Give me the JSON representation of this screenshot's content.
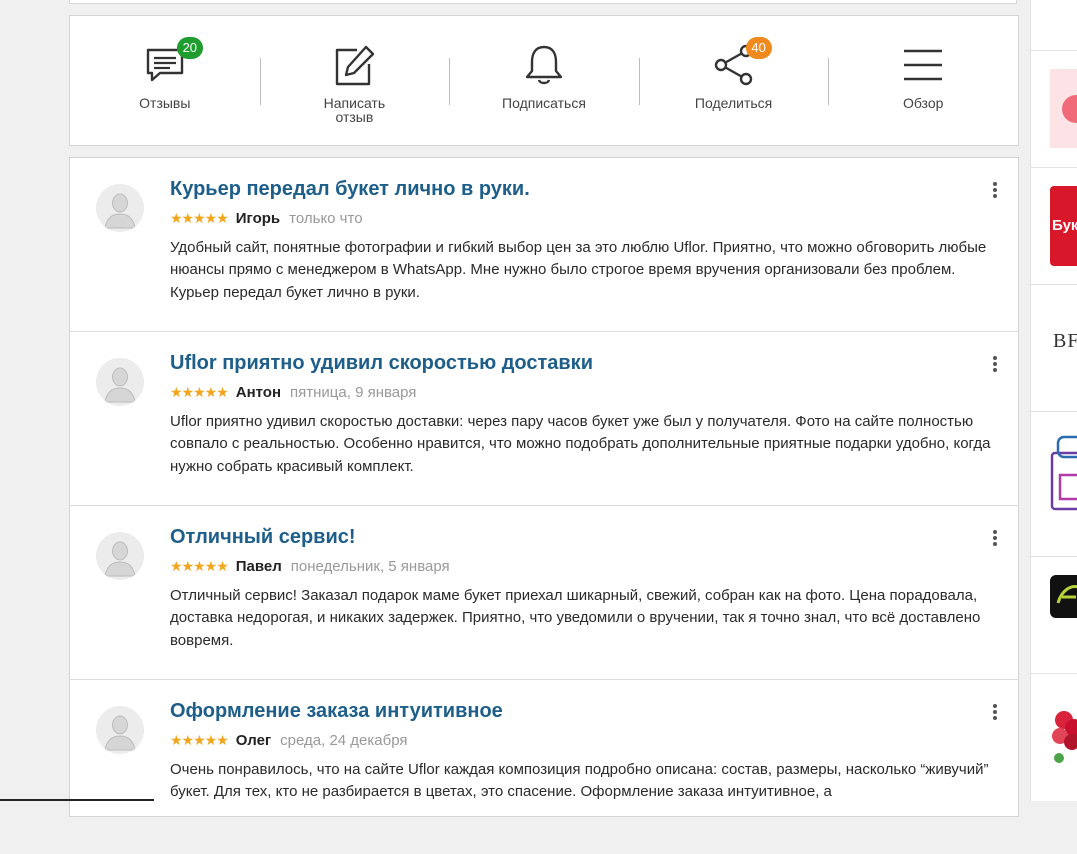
{
  "toolbar": {
    "items": [
      {
        "label": "Отзывы",
        "badge": "20",
        "icon": "comment-icon"
      },
      {
        "label": "Написать\nотзыв",
        "icon": "edit-icon"
      },
      {
        "label": "Подписаться",
        "icon": "bell-icon"
      },
      {
        "label": "Поделиться",
        "badge": "40",
        "icon": "share-icon"
      },
      {
        "label": "Обзор",
        "icon": "menu-icon"
      }
    ]
  },
  "colors": {
    "accent": "#1d5e8a",
    "stars": "#f3a51b",
    "badge_green": "#1f9d2e",
    "badge_orange": "#f08a1c"
  },
  "reviews": [
    {
      "title": "Курьер передал букет лично в руки.",
      "stars": "★★★★★",
      "rating": 5,
      "author": "Игорь",
      "date": "только что",
      "text": "Удобный сайт, понятные фотографии и гибкий выбор цен за это люблю Uflor. Приятно, что можно обговорить любые нюансы прямо с менеджером в WhatsApp. Мне нужно было строгое время вручения организовали без проблем. Курьер передал букет лично в руки."
    },
    {
      "title": "Uflor приятно удивил скоростью доставки",
      "stars": "★★★★★",
      "rating": 5,
      "author": "Антон",
      "date": "пятница, 9 января",
      "text": "Uflor приятно удивил скоростью доставки: через пару часов букет уже был у получателя. Фото на сайте полностью совпало с реальностью. Особенно нравится, что можно подобрать дополнительные приятные подарки удобно, когда нужно собрать красивый комплект."
    },
    {
      "title": "Отличный сервис!",
      "stars": "★★★★★",
      "rating": 5,
      "author": "Павел",
      "date": "понедельник, 5 января",
      "text": "Отличный сервис! Заказал подарок маме букет приехал шикарный, свежий, собран как на фото. Цена порадовала, доставка недорогая, и никаких задержек. Приятно, что уведомили о вручении, так я точно знал, что всё доставлено вовремя."
    },
    {
      "title": "Оформление заказа интуитивное",
      "stars": "★★★★★",
      "rating": 5,
      "author": "Олег",
      "date": "среда, 24 декабря",
      "text": "Очень понравилось, что на сайте Uflor каждая композиция подробно описана: состав, размеры, насколько “живучий” букет. Для тех, кто не разбирается в цветах, это спасение. Оформление заказа интуитивное, а"
    }
  ],
  "sidebar": {
    "thumb2_text": "Бук",
    "thumb3_text": "BF"
  }
}
